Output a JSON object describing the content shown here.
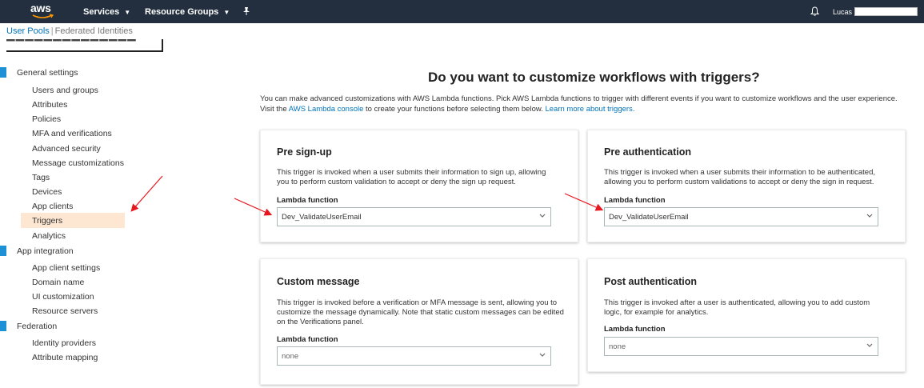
{
  "topnav": {
    "logo": "aws",
    "services": "Services",
    "resource_groups": "Resource Groups",
    "user": "Lucas"
  },
  "subnav": {
    "user_pools": "User Pools",
    "federated_identities": "Federated Identities"
  },
  "sidebar": {
    "general_settings": "General settings",
    "general_items": [
      "Users and groups",
      "Attributes",
      "Policies",
      "MFA and verifications",
      "Advanced security",
      "Message customizations",
      "Tags",
      "Devices",
      "App clients",
      "Triggers",
      "Analytics"
    ],
    "app_integration": "App integration",
    "app_items": [
      "App client settings",
      "Domain name",
      "UI customization",
      "Resource servers"
    ],
    "federation": "Federation",
    "federation_items": [
      "Identity providers",
      "Attribute mapping"
    ]
  },
  "main": {
    "title": "Do you want to customize workflows with triggers?",
    "intro_1": "You can make advanced customizations with AWS Lambda functions. Pick AWS Lambda functions to trigger with different events if you want to customize workflows and the user experience. Visit the ",
    "intro_link_1": "AWS Lambda console",
    "intro_2": " to create your functions before selecting them below. ",
    "intro_link_2": "Learn more about triggers."
  },
  "cards": [
    {
      "title": "Pre sign-up",
      "description": "This trigger is invoked when a user submits their information to sign up, allowing you to perform custom validation to accept or deny the sign up request.",
      "lambda_label": "Lambda function",
      "selected": "Dev_ValidateUserEmail"
    },
    {
      "title": "Pre authentication",
      "description": "This trigger is invoked when a user submits their information to be authenticated, allowing you to perform custom validations to accept or deny the sign in request.",
      "lambda_label": "Lambda function",
      "selected": "Dev_ValidateUserEmail"
    },
    {
      "title": "Custom message",
      "description": "This trigger is invoked before a verification or MFA message is sent, allowing you to customize the message dynamically. Note that static custom messages can be edited on the Verifications panel.",
      "lambda_label": "Lambda function",
      "selected": "none"
    },
    {
      "title": "Post authentication",
      "description": "This trigger is invoked after a user is authenticated, allowing you to add custom logic, for example for analytics.",
      "lambda_label": "Lambda function",
      "selected": "none"
    }
  ],
  "colors": {
    "nav_bg": "#232f3e",
    "link": "#0073bb",
    "section_bar": "#1e90d6",
    "active_item_bg": "#fde6d2",
    "annotation_arrow": "#e8171f"
  },
  "icons": {
    "pin": "pin-icon",
    "bell": "bell-icon",
    "chevron": "chevron-down-icon"
  }
}
